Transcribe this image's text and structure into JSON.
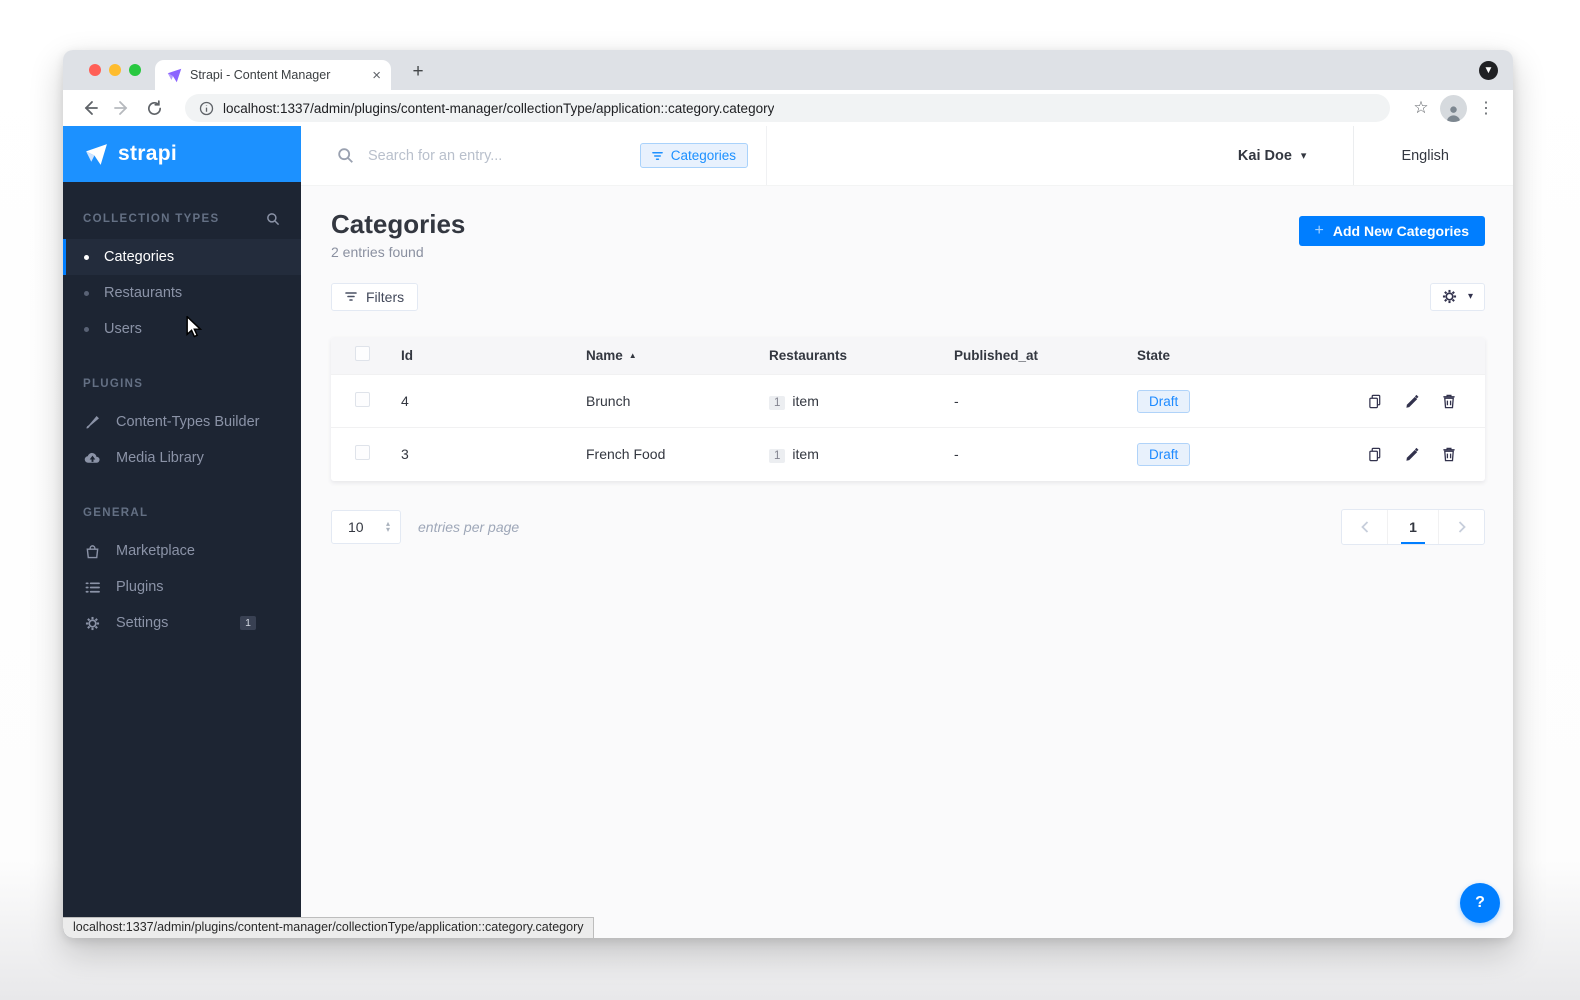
{
  "browser": {
    "tab_title": "Strapi - Content Manager",
    "url": "localhost:1337/admin/plugins/content-manager/collectionType/application::category.category",
    "status_url": "localhost:1337/admin/plugins/content-manager/collectionType/application::category.category"
  },
  "icons": {
    "close": "×",
    "new_tab": "+",
    "tab_chevron": "▼",
    "star": "☆",
    "menu": "⋮",
    "caret_down": "▾",
    "sort_asc": "▲",
    "stepper_up": "▴",
    "stepper_down": "▾",
    "plus": "+"
  },
  "sidebar": {
    "logo": "strapi",
    "sections": [
      {
        "title": "COLLECTION TYPES",
        "items": [
          {
            "label": "Categories"
          },
          {
            "label": "Restaurants"
          },
          {
            "label": "Users"
          }
        ]
      },
      {
        "title": "PLUGINS",
        "items": [
          {
            "label": "Content-Types Builder"
          },
          {
            "label": "Media Library"
          }
        ]
      },
      {
        "title": "GENERAL",
        "items": [
          {
            "label": "Marketplace"
          },
          {
            "label": "Plugins"
          },
          {
            "label": "Settings",
            "badge": "1"
          }
        ]
      }
    ]
  },
  "topbar": {
    "search_placeholder": "Search for an entry...",
    "filter_chip": "Categories",
    "user": "Kai Doe",
    "language": "English"
  },
  "page": {
    "title": "Categories",
    "subtitle": "2 entries found",
    "add_button": "Add New Categories",
    "filters_button": "Filters"
  },
  "table": {
    "columns": {
      "id": "Id",
      "name": "Name",
      "restaurants": "Restaurants",
      "published_at": "Published_at",
      "state": "State"
    },
    "rows": [
      {
        "id": "4",
        "name": "Brunch",
        "count": "1",
        "count_label": "item",
        "published_at": "-",
        "state": "Draft"
      },
      {
        "id": "3",
        "name": "French Food",
        "count": "1",
        "count_label": "item",
        "published_at": "-",
        "state": "Draft"
      }
    ]
  },
  "footer": {
    "per_page": "10",
    "per_page_label": "entries per page",
    "page": "1"
  },
  "help": {
    "label": "?"
  },
  "colors": {
    "accent": "#007eff",
    "logo_blue": "#1c91ff",
    "sidebar_bg": "#1d2533"
  }
}
